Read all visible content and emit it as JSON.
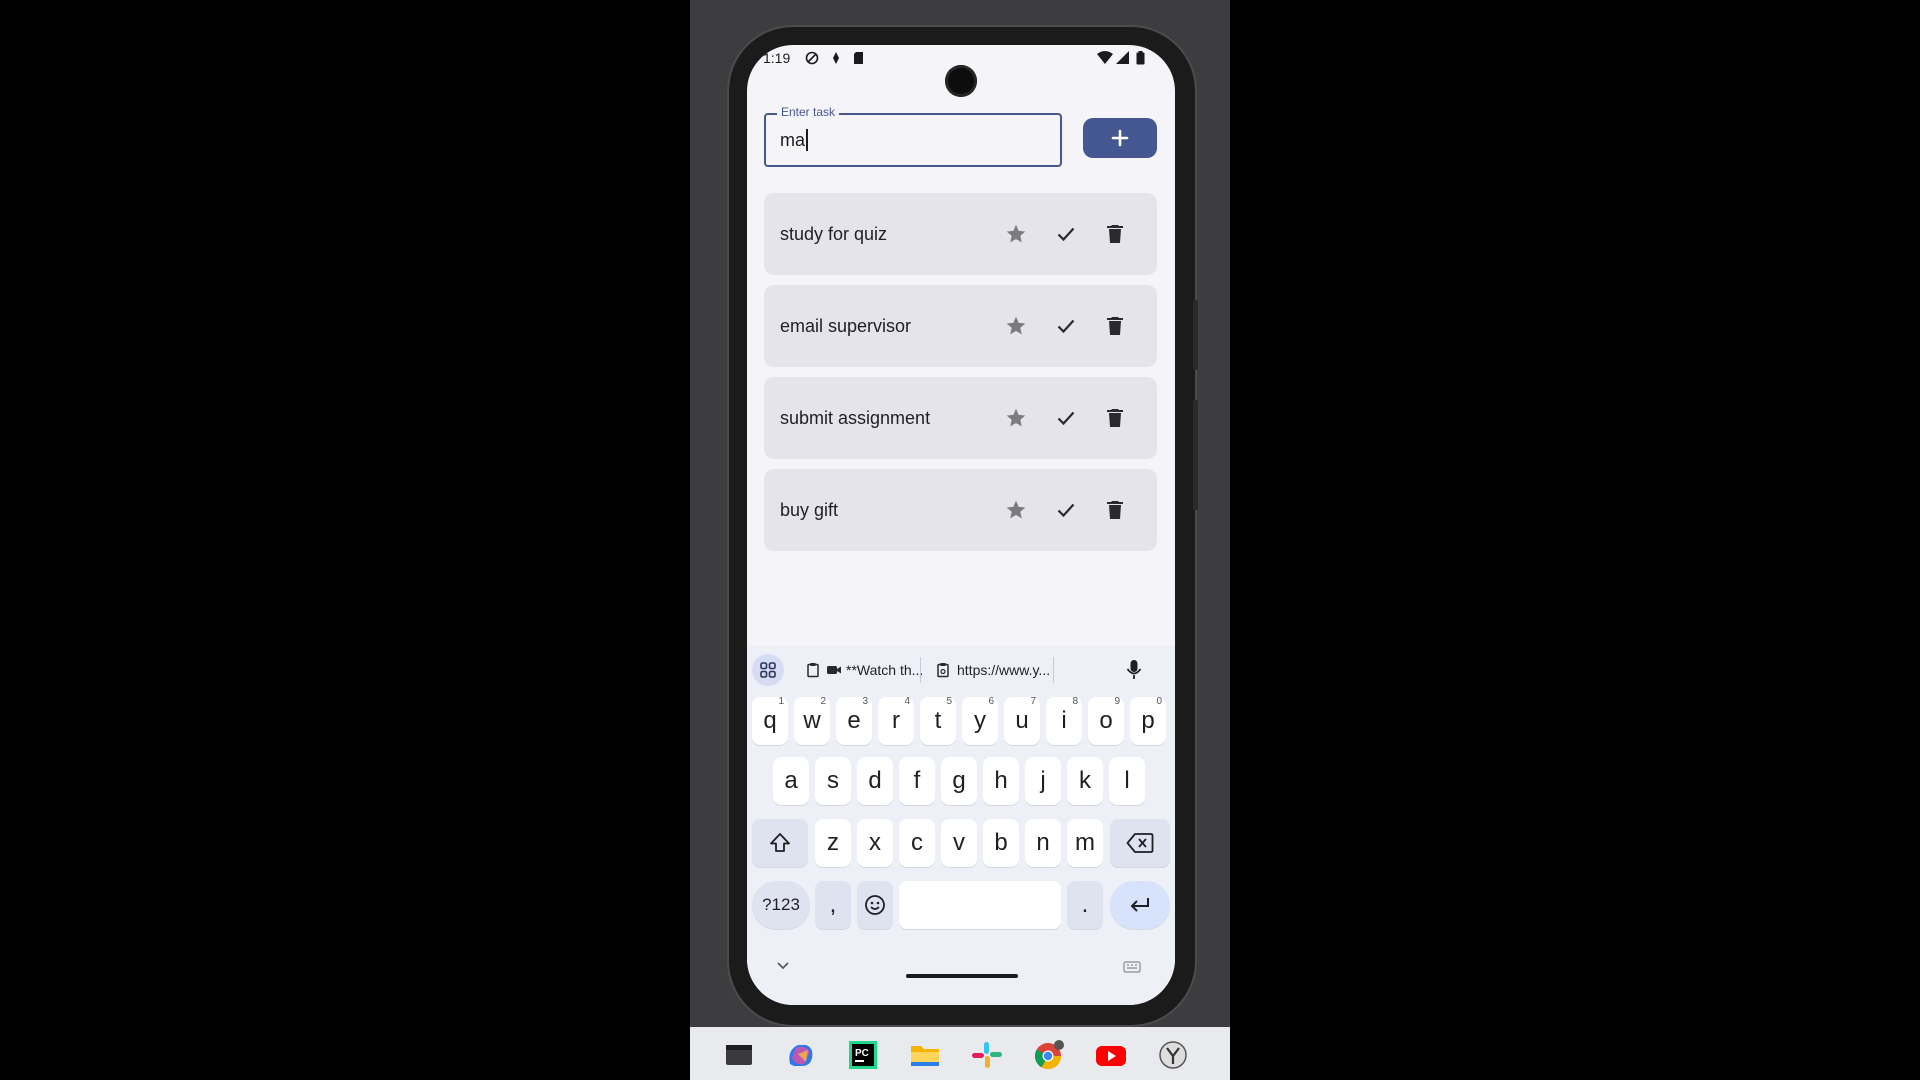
{
  "status_bar": {
    "time": "1:19"
  },
  "task_input": {
    "label": "Enter task",
    "value": "ma"
  },
  "add_button": {
    "label": "+"
  },
  "tasks": [
    {
      "label": "study for quiz"
    },
    {
      "label": "email supervisor"
    },
    {
      "label": "submit assignment"
    },
    {
      "label": "buy gift"
    }
  ],
  "keyboard": {
    "suggestions": [
      "**Watch th...",
      "https://www.y..."
    ],
    "row1": [
      {
        "k": "q",
        "h": "1"
      },
      {
        "k": "w",
        "h": "2"
      },
      {
        "k": "e",
        "h": "3"
      },
      {
        "k": "r",
        "h": "4"
      },
      {
        "k": "t",
        "h": "5"
      },
      {
        "k": "y",
        "h": "6"
      },
      {
        "k": "u",
        "h": "7"
      },
      {
        "k": "i",
        "h": "8"
      },
      {
        "k": "o",
        "h": "9"
      },
      {
        "k": "p",
        "h": "0"
      }
    ],
    "row2": [
      "a",
      "s",
      "d",
      "f",
      "g",
      "h",
      "j",
      "k",
      "l"
    ],
    "row3": [
      "z",
      "x",
      "c",
      "v",
      "b",
      "n",
      "m"
    ],
    "symbols_label": "?123",
    "comma_label": ",",
    "period_label": "."
  },
  "colors": {
    "accent": "#445790",
    "card_bg": "#e4e4ea",
    "screen_bg": "#f5f5f9"
  },
  "icons": {
    "task_actions": [
      "star-icon",
      "check-icon",
      "trash-icon"
    ],
    "keyboard": [
      "apps-grid-icon",
      "clipboard-icon",
      "mic-icon",
      "shift-icon",
      "backspace-icon",
      "emoji-icon",
      "enter-icon"
    ],
    "taskbar": [
      "file-manager-icon",
      "copilot-icon",
      "pycharm-icon",
      "folder-icon",
      "slack-icon",
      "chrome-icon",
      "youtube-icon",
      "yandex-icon"
    ]
  }
}
